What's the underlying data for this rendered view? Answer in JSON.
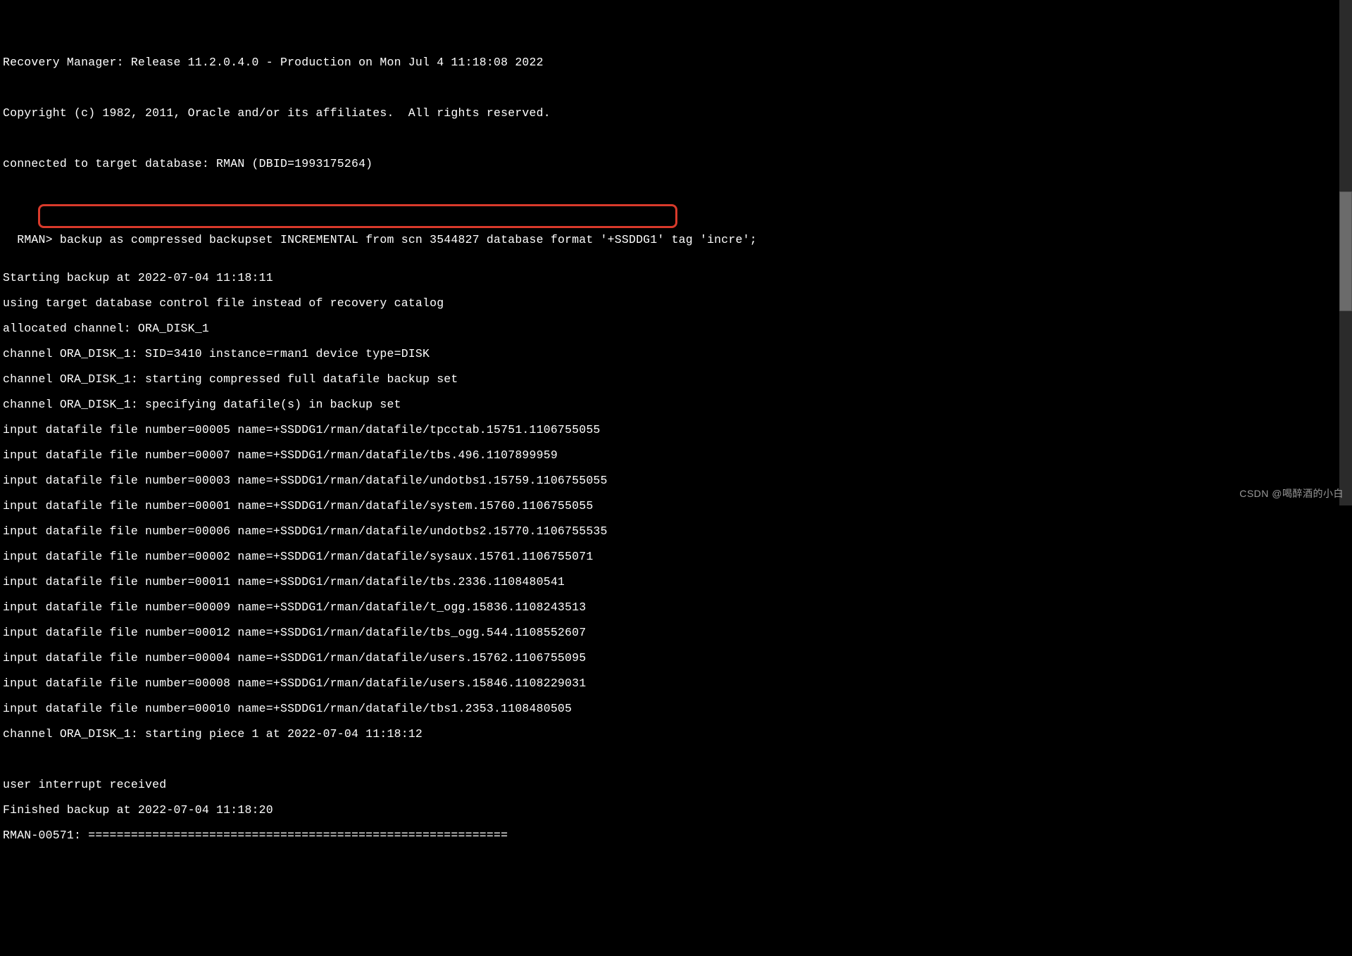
{
  "header": {
    "release": "Recovery Manager: Release 11.2.0.4.0 - Production on Mon Jul 4 11:18:08 2022",
    "copyright": "Copyright (c) 1982, 2011, Oracle and/or its affiliates.  All rights reserved.",
    "connected": "connected to target database: RMAN (DBID=1993175264)"
  },
  "prompt": {
    "label": "RMAN>",
    "command": " backup as compressed backupset INCREMENTAL from scn 3544827 database format '+SSDDG1' tag 'incre';"
  },
  "output": {
    "start": "Starting backup at 2022-07-04 11:18:11",
    "using": "using target database control file instead of recovery catalog",
    "allocated": "allocated channel: ORA_DISK_1",
    "channel_sid": "channel ORA_DISK_1: SID=3410 instance=rman1 device type=DISK",
    "channel_starting": "channel ORA_DISK_1: starting compressed full datafile backup set",
    "channel_specifying": "channel ORA_DISK_1: specifying datafile(s) in backup set",
    "datafiles": [
      "input datafile file number=00005 name=+SSDDG1/rman/datafile/tpcctab.15751.1106755055",
      "input datafile file number=00007 name=+SSDDG1/rman/datafile/tbs.496.1107899959",
      "input datafile file number=00003 name=+SSDDG1/rman/datafile/undotbs1.15759.1106755055",
      "input datafile file number=00001 name=+SSDDG1/rman/datafile/system.15760.1106755055",
      "input datafile file number=00006 name=+SSDDG1/rman/datafile/undotbs2.15770.1106755535",
      "input datafile file number=00002 name=+SSDDG1/rman/datafile/sysaux.15761.1106755071",
      "input datafile file number=00011 name=+SSDDG1/rman/datafile/tbs.2336.1108480541",
      "input datafile file number=00009 name=+SSDDG1/rman/datafile/t_ogg.15836.1108243513",
      "input datafile file number=00012 name=+SSDDG1/rman/datafile/tbs_ogg.544.1108552607",
      "input datafile file number=00004 name=+SSDDG1/rman/datafile/users.15762.1106755095",
      "input datafile file number=00008 name=+SSDDG1/rman/datafile/users.15846.1108229031",
      "input datafile file number=00010 name=+SSDDG1/rman/datafile/tbs1.2353.1108480505"
    ],
    "channel_piece": "channel ORA_DISK_1: starting piece 1 at 2022-07-04 11:18:12",
    "interrupt": "user interrupt received",
    "finished": "Finished backup at 2022-07-04 11:18:20",
    "rman_err": "RMAN-00571: ==========================================================="
  },
  "watermark": "CSDN @喝醉酒的小白"
}
